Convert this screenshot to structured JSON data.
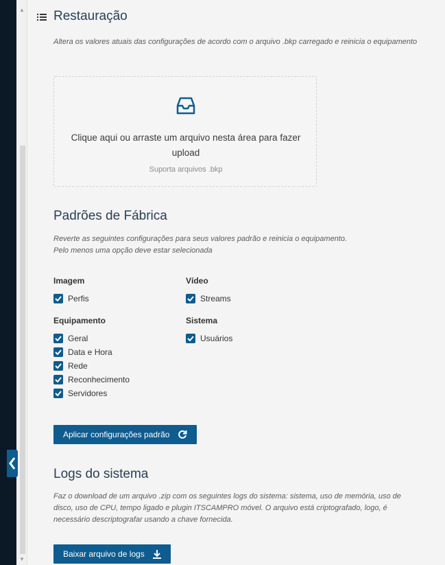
{
  "restore": {
    "title": "Restauração",
    "description": "Altera os valores atuais das configurações de acordo com o arquivo .bkp carregado e reinicia o equipamento",
    "dropzone_text": "Clique aqui ou arraste um arquivo nesta área para fazer upload",
    "dropzone_sub": "Suporta arquivos .bkp"
  },
  "factory": {
    "title": "Padrões de Fábrica",
    "description_line1": "Reverte as seguintes configurações para seus valores padrão e reinicia o equipamento.",
    "description_line2": "Pelo menos uma opção deve estar selecionada",
    "groups": {
      "imagem": {
        "label": "Imagem",
        "items": [
          {
            "label": "Perfis",
            "checked": true
          }
        ]
      },
      "video": {
        "label": "Vídeo",
        "items": [
          {
            "label": "Streams",
            "checked": true
          }
        ]
      },
      "equipamento": {
        "label": "Equipamento",
        "items": [
          {
            "label": "Geral",
            "checked": true
          },
          {
            "label": "Data e Hora",
            "checked": true
          },
          {
            "label": "Rede",
            "checked": true
          },
          {
            "label": "Reconhecimento",
            "checked": true
          },
          {
            "label": "Servidores",
            "checked": true
          }
        ]
      },
      "sistema": {
        "label": "Sistema",
        "items": [
          {
            "label": "Usuários",
            "checked": true
          }
        ]
      }
    },
    "apply_button": "Aplicar configurações padrão"
  },
  "logs": {
    "title": "Logs do sistema",
    "description_line1": "Faz o download de um arquivo .zip com os seguintes logs do sistema: sistema, uso de memória, uso de",
    "description_line2": "disco, uso de CPU, tempo ligado e plugin ITSCAMPRO móvel. O arquivo está criptografado, logo, é",
    "description_line3": "necessário descriptografar usando a chave fornecida.",
    "download_button": "Baixar arquivo de logs"
  },
  "icons": {
    "menu": "list-icon",
    "dropzone": "inbox-icon",
    "apply": "refresh-icon",
    "download": "download-icon",
    "collapse": "chevron-left-icon"
  },
  "colors": {
    "accent": "#0f5c8f",
    "rail": "#0b1826",
    "title": "#2a3f55"
  }
}
